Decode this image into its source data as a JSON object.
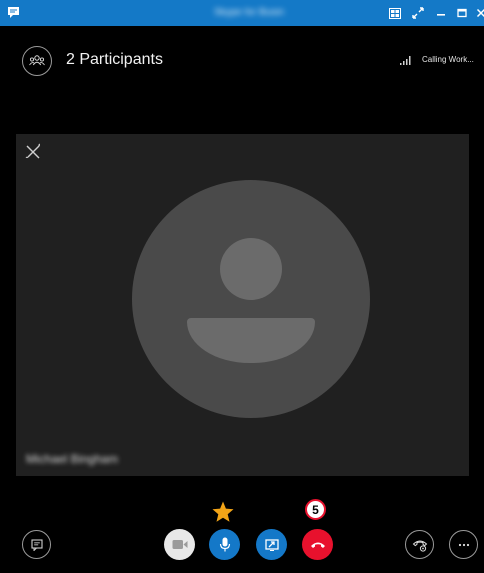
{
  "titlebar": {
    "window_title": "Skype for Business",
    "buttons": [
      {
        "name": "layout",
        "icon": "layout-icon"
      },
      {
        "name": "fullscreen",
        "icon": "fullscreen-icon"
      },
      {
        "name": "minimize",
        "icon": "minimize-icon"
      },
      {
        "name": "maximize",
        "icon": "maximize-icon"
      },
      {
        "name": "close",
        "icon": "close-icon"
      }
    ],
    "accent_color": "#1479c7"
  },
  "header": {
    "participants_label": "2 Participants",
    "status_text": "Calling Work..."
  },
  "video": {
    "caller_name": "Michael Bingham",
    "mic_status_icon": "mic-muted-icon"
  },
  "controls": {
    "star_color": "#f2a417",
    "badge_count": "5",
    "hangup_color": "#e8112d",
    "mic_color": "#1478c8",
    "share_color": "#1478c8",
    "buttons": [
      "im-icon",
      "video-icon",
      "microphone-icon",
      "share-screen-icon",
      "hang-up-icon",
      "call-controls-icon",
      "more-options-icon"
    ]
  }
}
